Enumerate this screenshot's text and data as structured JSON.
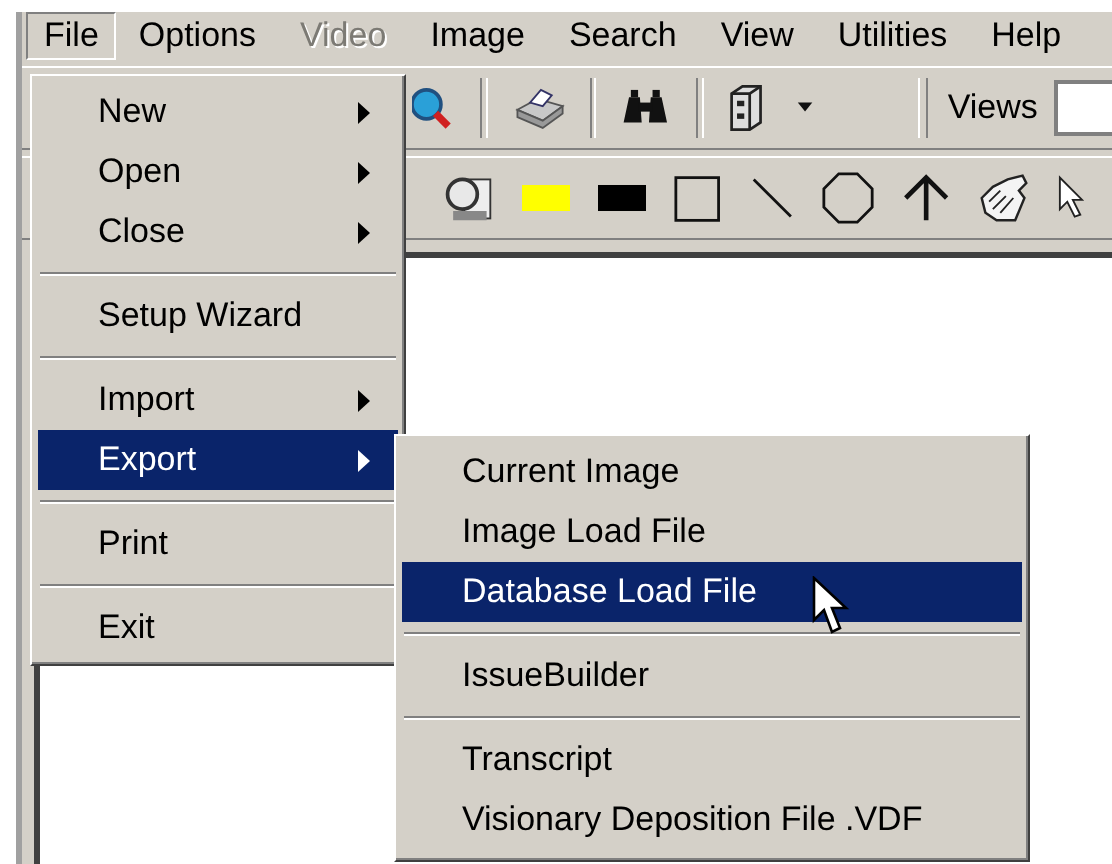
{
  "menubar": [
    {
      "label": "File",
      "selected": true,
      "disabled": false
    },
    {
      "label": "Options",
      "selected": false,
      "disabled": false
    },
    {
      "label": "Video",
      "selected": false,
      "disabled": true
    },
    {
      "label": "Image",
      "selected": false,
      "disabled": false
    },
    {
      "label": "Search",
      "selected": false,
      "disabled": false
    },
    {
      "label": "View",
      "selected": false,
      "disabled": false
    },
    {
      "label": "Utilities",
      "selected": false,
      "disabled": false
    },
    {
      "label": "Help",
      "selected": false,
      "disabled": false
    }
  ],
  "toolbar": {
    "views_label": "Views"
  },
  "file_menu": [
    {
      "kind": "item",
      "label": "New",
      "submenu": true,
      "selected": false
    },
    {
      "kind": "item",
      "label": "Open",
      "submenu": true,
      "selected": false
    },
    {
      "kind": "item",
      "label": "Close",
      "submenu": true,
      "selected": false
    },
    {
      "kind": "separator"
    },
    {
      "kind": "item",
      "label": "Setup Wizard",
      "submenu": false,
      "selected": false
    },
    {
      "kind": "separator"
    },
    {
      "kind": "item",
      "label": "Import",
      "submenu": true,
      "selected": false
    },
    {
      "kind": "item",
      "label": "Export",
      "submenu": true,
      "selected": true
    },
    {
      "kind": "separator"
    },
    {
      "kind": "item",
      "label": "Print",
      "submenu": false,
      "selected": false
    },
    {
      "kind": "separator"
    },
    {
      "kind": "item",
      "label": "Exit",
      "submenu": false,
      "selected": false
    }
  ],
  "export_menu": [
    {
      "kind": "item",
      "label": "Current Image",
      "selected": false
    },
    {
      "kind": "item",
      "label": "Image Load File",
      "selected": false
    },
    {
      "kind": "item",
      "label": "Database Load File",
      "selected": true
    },
    {
      "kind": "separator"
    },
    {
      "kind": "item",
      "label": "IssueBuilder",
      "selected": false
    },
    {
      "kind": "separator"
    },
    {
      "kind": "item",
      "label": "Transcript",
      "selected": false
    },
    {
      "kind": "item",
      "label": "Visionary Deposition File .VDF",
      "selected": false
    }
  ]
}
